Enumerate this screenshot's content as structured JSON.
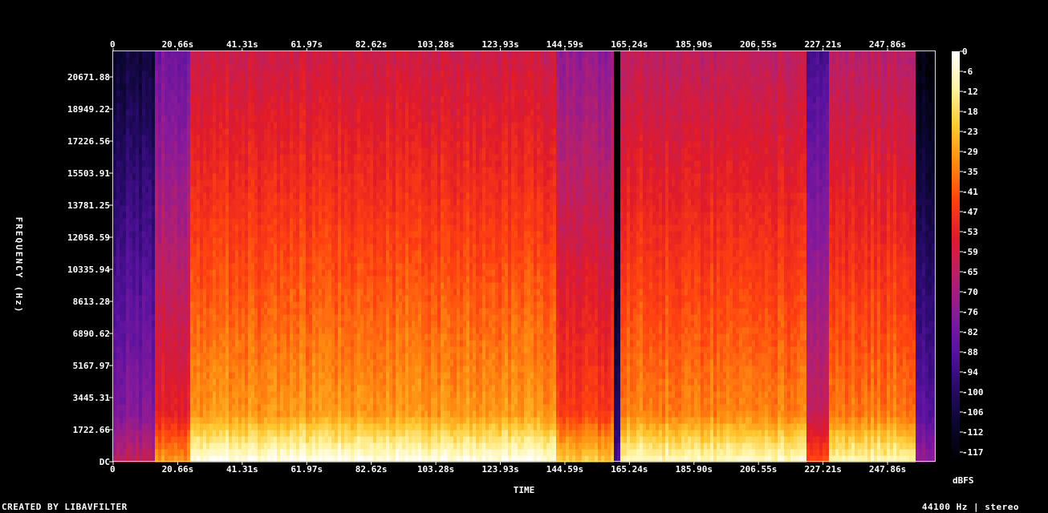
{
  "chart_data": {
    "type": "heatmap",
    "xlabel": "TIME",
    "ylabel": "FREQUENCY (Hz)",
    "x_ticks": [
      "0",
      "20.66s",
      "41.31s",
      "61.97s",
      "82.62s",
      "103.28s",
      "123.93s",
      "144.59s",
      "165.24s",
      "185.90s",
      "206.55s",
      "227.21s",
      "247.86s"
    ],
    "x_tick_values": [
      0,
      20.66,
      41.31,
      61.97,
      82.62,
      103.28,
      123.93,
      144.59,
      165.24,
      185.9,
      206.55,
      227.21,
      247.86
    ],
    "x_max_seconds": 263,
    "y_ticks": [
      "DC",
      "1722.66",
      "3445.31",
      "5167.97",
      "6890.62",
      "8613.28",
      "10335.94",
      "12058.59",
      "13781.25",
      "15503.91",
      "17226.56",
      "18949.22",
      "20671.88"
    ],
    "y_tick_values": [
      0,
      1722.66,
      3445.31,
      5167.97,
      6890.62,
      8613.28,
      10335.94,
      12058.59,
      13781.25,
      15503.91,
      17226.56,
      18949.22,
      20671.88
    ],
    "y_max_hz": 22050,
    "colorbar_unit": "dBFS",
    "colorbar_ticks": [
      "0",
      "-6",
      "-12",
      "-18",
      "-23",
      "-29",
      "-35",
      "-41",
      "-47",
      "-53",
      "-59",
      "-65",
      "-70",
      "-76",
      "-82",
      "-88",
      "-94",
      "-100",
      "-106",
      "-112",
      "-117"
    ],
    "colormap": [
      "#000000",
      "#0a0630",
      "#2a0a6e",
      "#5a12a0",
      "#8a1a9a",
      "#b8206a",
      "#e01a2a",
      "#ff4010",
      "#ff8a10",
      "#ffc830",
      "#fff4a0",
      "#ffffff"
    ],
    "time_segments": [
      {
        "start": 0,
        "end": 13.5,
        "level": 0.38
      },
      {
        "start": 13.5,
        "end": 25,
        "level": 0.6
      },
      {
        "start": 25,
        "end": 142,
        "level": 0.78
      },
      {
        "start": 142,
        "end": 160,
        "level": 0.66
      },
      {
        "start": 160,
        "end": 162,
        "level": 0.2
      },
      {
        "start": 162,
        "end": 222,
        "level": 0.75
      },
      {
        "start": 222,
        "end": 229,
        "level": 0.5
      },
      {
        "start": 229,
        "end": 257,
        "level": 0.74
      },
      {
        "start": 257,
        "end": 263,
        "level": 0.3
      }
    ]
  },
  "footer": {
    "left": "CREATED BY LIBAVFILTER",
    "right": "44100 Hz | stereo"
  }
}
